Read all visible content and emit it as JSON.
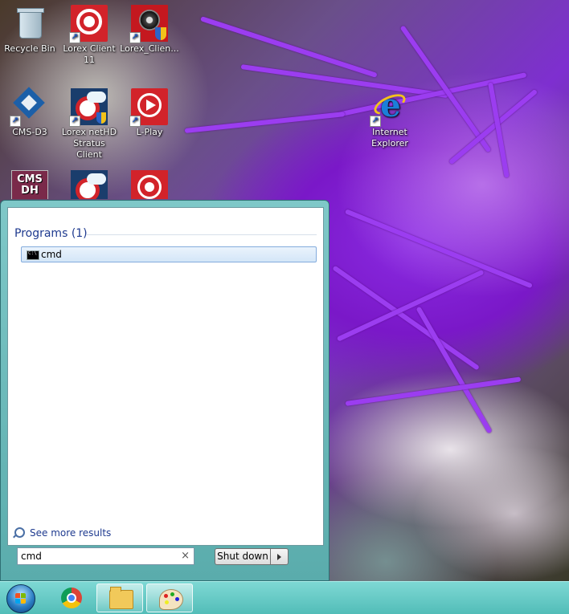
{
  "desktop": {
    "icons": [
      {
        "label": "Recycle Bin",
        "icon": "recycle-bin-icon"
      },
      {
        "label": "Lorex Client 11",
        "icon": "lorex-client-icon"
      },
      {
        "label": "Lorex_Clien...",
        "icon": "lorex-client-shield-icon"
      },
      {
        "label": "CMS-D3",
        "icon": "cms-d3-icon"
      },
      {
        "label": "Lorex netHD Stratus Client",
        "icon": "lorex-nethd-icon"
      },
      {
        "label": "L-Play",
        "icon": "l-play-icon"
      },
      {
        "label": "Internet Explorer",
        "icon": "internet-explorer-icon"
      },
      {
        "label": "CMS DH",
        "icon": "cms-dh-icon"
      }
    ]
  },
  "start_menu": {
    "section_header": "Programs (1)",
    "results": [
      {
        "label": "cmd",
        "icon": "cmd-icon"
      }
    ],
    "see_more": "See more results",
    "search": {
      "value": "cmd",
      "clear": "×"
    },
    "shutdown_label": "Shut down"
  },
  "taskbar": {
    "items": [
      {
        "name": "start-button",
        "icon": "windows-logo-icon"
      },
      {
        "name": "chrome",
        "icon": "chrome-icon"
      },
      {
        "name": "windows-explorer",
        "icon": "folder-icon"
      },
      {
        "name": "paint",
        "icon": "paint-palette-icon"
      }
    ]
  },
  "colors": {
    "taskbar": "#52bdb8",
    "start_menu_frame": "#5aacac",
    "link_blue": "#1e3a8f",
    "selection": "#d4e6f8",
    "lorex_red": "#d2232a",
    "wallpaper_purple": "#8a2be2"
  }
}
